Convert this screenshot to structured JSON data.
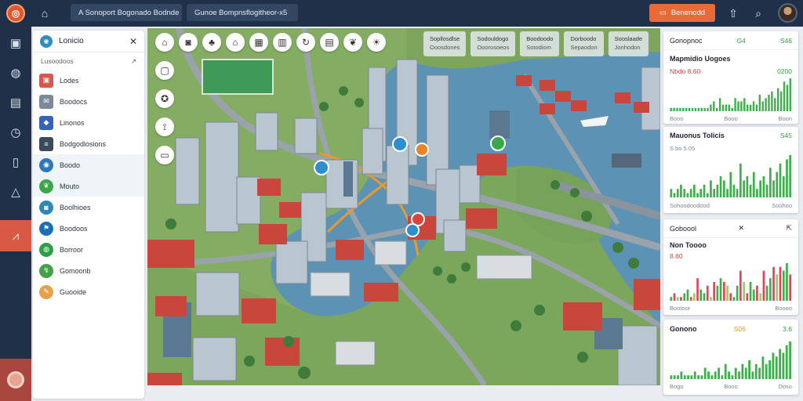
{
  "topbar": {
    "logo_icon": "logo-icon",
    "pill1": "A Sonoport Bogonado Bodnde",
    "pill2": "Gunoe Bompnsflogitheor-x5",
    "cta_label": "Benenodd",
    "icons": [
      "book-icon",
      "walk-icon",
      "search-icon"
    ]
  },
  "rail": {
    "items": [
      "layers-icon",
      "globe-icon",
      "briefcase-icon",
      "clock-icon",
      "info-icon",
      "alert-icon",
      "chart-icon"
    ]
  },
  "sidebar": {
    "title": "Lonicio",
    "subtitle": "Lusoodoos",
    "items": [
      {
        "label": "Lodes",
        "icon": "image-icon",
        "color": "#d9574a"
      },
      {
        "label": "Boodocs",
        "icon": "mail-icon",
        "color": "#7a8a9a"
      },
      {
        "label": "Linonos",
        "icon": "tag-icon",
        "color": "#3563b8"
      },
      {
        "label": "Bodgodlosions",
        "icon": "list-icon",
        "color": "#3a4b5c"
      },
      {
        "label": "Boodo",
        "icon": "pin-icon",
        "color": "#2e77b8"
      },
      {
        "label": "Mouto",
        "icon": "leaf-icon",
        "color": "#3aa848"
      },
      {
        "label": "Boolhioes",
        "icon": "camera-icon",
        "color": "#2a89b7"
      },
      {
        "label": "Boodoos",
        "icon": "flag-icon",
        "color": "#1d6fb3"
      },
      {
        "label": "Borroor",
        "icon": "globe-icon",
        "color": "#2f9f47"
      },
      {
        "label": "Gomoonb",
        "icon": "route-icon",
        "color": "#43a047"
      },
      {
        "label": "Guooide",
        "icon": "note-icon",
        "color": "#e6a14a"
      }
    ]
  },
  "map": {
    "tabs": [
      {
        "l1": "Sopllosdlse",
        "l2": "Ooosdones"
      },
      {
        "l1": "Sodouldogo",
        "l2": "Ooorosoeos"
      },
      {
        "l1": "Boodoodo",
        "l2": "Sotodiom"
      },
      {
        "l1": "Dorboodo",
        "l2": "Sepaodon"
      },
      {
        "l1": "Sooslaade",
        "l2": "Jonhodon"
      }
    ]
  },
  "cards": [
    {
      "title": "Gonopnoc",
      "value": "G4",
      "value2": "S46",
      "axis": [
        "Booo",
        "Booo",
        "Boon"
      ],
      "bars": [
        1,
        1,
        1,
        1,
        1,
        1,
        1,
        1,
        1,
        1,
        1,
        1,
        1,
        2,
        3,
        1,
        4,
        2,
        2,
        2,
        1,
        4,
        3,
        3,
        4,
        2,
        2,
        3,
        2,
        5,
        3,
        4,
        5,
        6,
        4,
        7,
        6,
        9,
        8,
        10
      ]
    },
    {
      "title": "Mapmidio Uogoes",
      "value": "Nbdo  8.60",
      "value2": "0200",
      "axis": [
        "",
        "",
        ""
      ],
      "bars": []
    },
    {
      "title": "Mauonus Tolicis",
      "value": "S.bo 5.05",
      "value2": "S45",
      "axis": [
        "Sohoodoodood",
        "Soohoo"
      ],
      "bars": [
        2,
        1,
        2,
        3,
        2,
        1,
        2,
        3,
        1,
        2,
        3,
        1,
        4,
        2,
        3,
        5,
        4,
        2,
        6,
        3,
        2,
        8,
        4,
        5,
        3,
        6,
        2,
        4,
        5,
        3,
        7,
        4,
        6,
        8,
        5,
        9,
        10
      ]
    },
    {
      "title": "Goboool",
      "value": "",
      "value2": "",
      "axis": [],
      "bars": []
    },
    {
      "title": "Non Toooo",
      "value": "8.60",
      "value2": "",
      "axis": [
        "Bootoor",
        "Boooo"
      ],
      "bars": [
        1,
        2,
        1,
        1,
        2,
        3,
        1,
        2,
        6,
        3,
        2,
        4,
        1,
        5,
        4,
        6,
        5,
        4,
        2,
        1,
        4,
        8,
        5,
        2,
        5,
        3,
        4,
        2,
        8,
        4,
        6,
        9,
        7,
        9,
        8,
        10,
        7
      ]
    },
    {
      "title": "Gonono",
      "value": "S06",
      "value2": "3.6",
      "axis": [
        "Bogo",
        "Booo",
        "Doso"
      ],
      "bars": [
        1,
        1,
        1,
        2,
        1,
        1,
        1,
        2,
        1,
        1,
        3,
        2,
        1,
        2,
        3,
        1,
        4,
        2,
        1,
        3,
        2,
        4,
        3,
        5,
        2,
        4,
        3,
        6,
        4,
        5,
        7,
        6,
        8,
        7,
        9,
        10
      ]
    }
  ]
}
